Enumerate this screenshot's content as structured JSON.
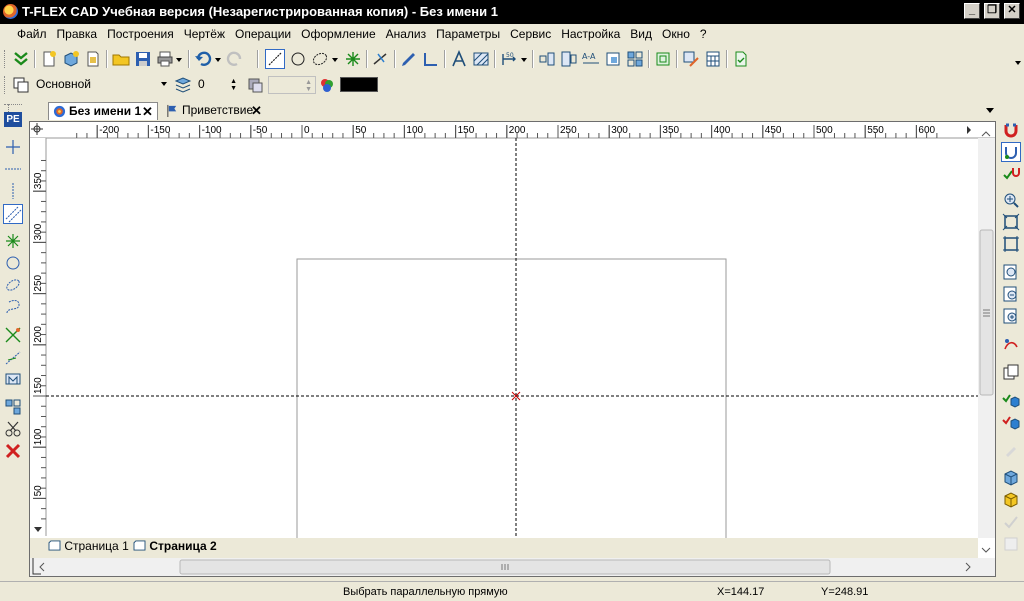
{
  "window": {
    "title": "T-FLEX CAD Учебная версия (Незарегистрированная копия) - Без имени 1",
    "minimize_glyph": "_",
    "restore_glyph": "❐",
    "close_glyph": "✕"
  },
  "menu": {
    "items": [
      "Файл",
      "Правка",
      "Построения",
      "Чертёж",
      "Операции",
      "Оформление",
      "Анализ",
      "Параметры",
      "Сервис",
      "Настройка",
      "Вид",
      "Окно",
      "?"
    ]
  },
  "properties_bar": {
    "layer_value": "Основной",
    "level_value": "0",
    "priority_value": "",
    "color_value": "#000000"
  },
  "doc_tabs": [
    {
      "label": "Без имени 1",
      "active": true
    },
    {
      "label": "Приветствие",
      "active": false
    }
  ],
  "ruler": {
    "horizontal_ticks": [
      "-200",
      "-150",
      "-100",
      "-50",
      "0",
      "50",
      "100",
      "150",
      "200",
      "250",
      "300",
      "350",
      "400",
      "450",
      "500",
      "550",
      "600"
    ],
    "vertical_ticks": [
      "350",
      "300",
      "250",
      "200",
      "150",
      "100",
      "50"
    ]
  },
  "page_tabs": [
    {
      "label": "Страница 1",
      "active": false
    },
    {
      "label": "Страница 2",
      "active": true
    }
  ],
  "status": {
    "message": "Выбрать параллельную прямую",
    "x_readout": "X=144.17",
    "y_readout": "Y=248.91"
  },
  "colors": {
    "titlebar": "#000000",
    "chrome": "#ece9d8",
    "canvas": "#ffffff",
    "cursor_marker": "#cc0000"
  }
}
